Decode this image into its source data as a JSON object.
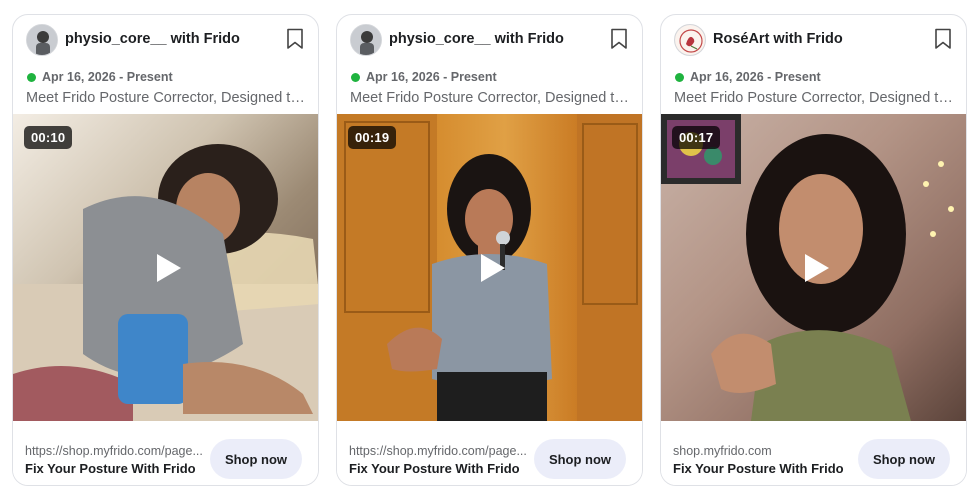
{
  "cards": [
    {
      "advertiser": "physio_core__ with Frido",
      "avatar_icon": "user-photo-avatar",
      "status_color": "#1fb33f",
      "date_range": "Apr 16, 2026 - Present",
      "body": "Meet Frido Posture Corrector, Designed to...",
      "video_duration": "00:10",
      "link_url": "https://shop.myfrido.com/page...",
      "link_title": "Fix Your Posture With Frido",
      "cta_label": "Shop now"
    },
    {
      "advertiser": "physio_core__ with Frido",
      "avatar_icon": "user-photo-avatar",
      "status_color": "#1fb33f",
      "date_range": "Apr 16, 2026 - Present",
      "body": "Meet Frido Posture Corrector, Designed to...",
      "video_duration": "00:19",
      "link_url": "https://shop.myfrido.com/page...",
      "link_title": "Fix Your Posture With Frido",
      "cta_label": "Shop now"
    },
    {
      "advertiser": "RoséArt with Frido",
      "avatar_icon": "roseart-logo-avatar",
      "status_color": "#1fb33f",
      "date_range": "Apr 16, 2026 - Present",
      "body": "Meet Frido Posture Corrector, Designed to...",
      "video_duration": "00:17",
      "link_url": "shop.myfrido.com",
      "link_title": "Fix Your Posture With Frido",
      "cta_label": "Shop now"
    }
  ],
  "colors": {
    "accent_button": "#ebedf9",
    "text_primary": "#1c1e21",
    "text_secondary": "#65676b",
    "active_dot": "#1fb33f"
  }
}
